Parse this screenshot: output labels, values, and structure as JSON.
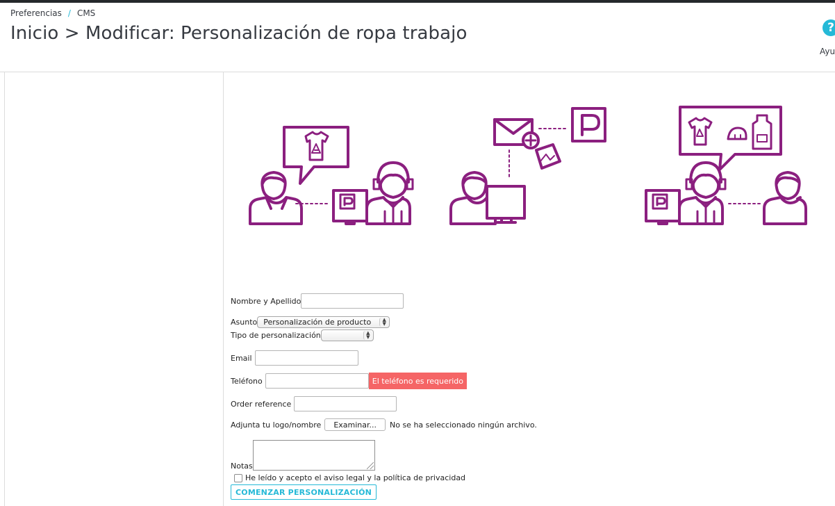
{
  "breadcrumb": {
    "parent": "Preferencias",
    "separator": "/",
    "current": "CMS"
  },
  "page_title": "Inicio > Modificar: Personalización de ropa trabajo",
  "help": {
    "label": "Ayu"
  },
  "illustration": {
    "sign_letter": "P"
  },
  "form": {
    "name_label": "Nombre y Apellido",
    "name_value": "",
    "subject_label": "Asunto",
    "subject_selected": "Personalización de producto",
    "custom_type_label": "Tipo de personalización",
    "custom_type_selected": "",
    "email_label": "Email",
    "email_value": "",
    "phone_label": "Teléfono",
    "phone_value": "",
    "phone_error": "El teléfono es requerido",
    "order_ref_label": "Order reference",
    "order_ref_value": "",
    "logo_label": "Adjunta tu logo/nombre",
    "file_button": "Examinar...",
    "file_status": "No se ha seleccionado ningún archivo.",
    "notes_label": "Notas",
    "privacy_label": "He leído y acepto el aviso legal y la política de privacidad",
    "privacy_checked": false,
    "submit_label": "COMENZAR PERSONALIZACIÓN"
  },
  "colors": {
    "illustration": "#8b1f7f",
    "accent": "#25b9d7",
    "error": "#f56566"
  }
}
